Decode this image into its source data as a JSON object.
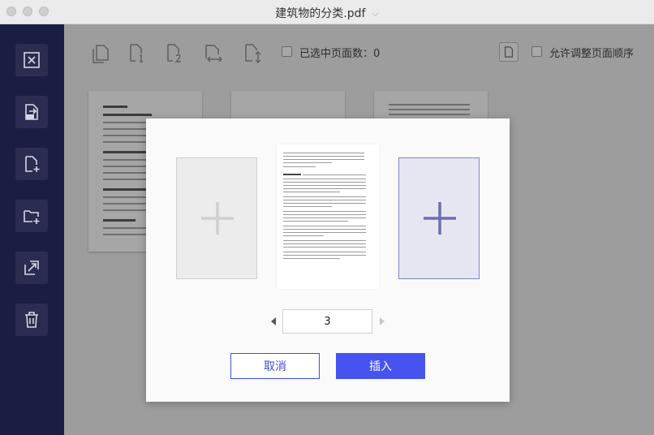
{
  "window": {
    "title": "建筑物的分类.pdf",
    "dropdown_icon": "chevron-down-icon"
  },
  "sidebar": {
    "items": [
      {
        "icon": "close-box-icon"
      },
      {
        "icon": "extract-page-icon"
      },
      {
        "icon": "insert-page-icon"
      },
      {
        "icon": "insert-from-folder-icon"
      },
      {
        "icon": "replace-page-icon"
      },
      {
        "icon": "delete-icon"
      }
    ]
  },
  "toolbar": {
    "tools": [
      {
        "icon": "copy-pages-icon"
      },
      {
        "icon": "page-1-icon"
      },
      {
        "icon": "page-2-icon"
      },
      {
        "icon": "horizontal-arrange-icon"
      },
      {
        "icon": "vertical-arrange-icon"
      }
    ],
    "selected_label": "已选中页面数：0",
    "allow_reorder_label": "允许调整页面顺序"
  },
  "dialog": {
    "page_number": "3",
    "cancel_label": "取消",
    "insert_label": "插入"
  },
  "colors": {
    "sidebar_bg": "#1b1d43",
    "accent": "#4653f0",
    "selected_slot": "#e6e6f3"
  }
}
